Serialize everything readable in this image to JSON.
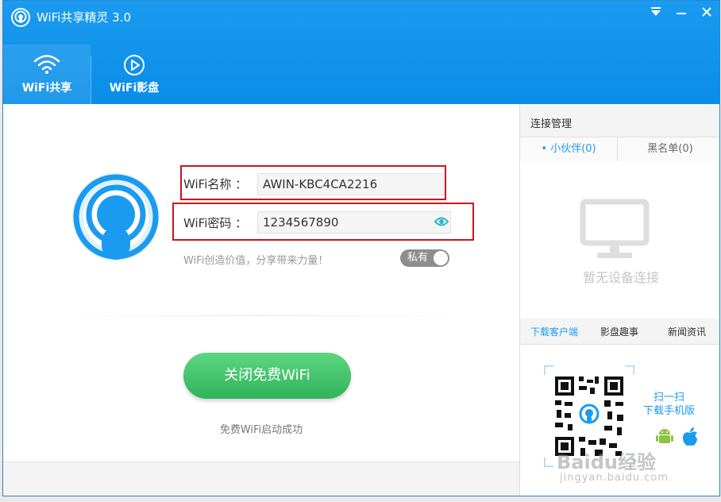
{
  "app": {
    "title": "WiFi共享精灵 3.0"
  },
  "nav": {
    "tabs": [
      {
        "label": "WiFi共享"
      },
      {
        "label": "WiFi影盘"
      }
    ]
  },
  "form": {
    "name_label": "WiFi名称 ：",
    "name_value": "AWIN-KBC4CA2216",
    "password_label": "WiFi密码 ：",
    "password_value": "1234567890",
    "slogan": "WiFi创造价值，分享带来力量！",
    "privacy_toggle": "私有"
  },
  "action": {
    "button_label": "关闭免费WiFi",
    "status": "免费WiFi启动成功"
  },
  "side": {
    "title": "连接管理",
    "tabs": [
      "• 小伙伴(0)",
      "黑名单(0)"
    ],
    "empty_text": "暂无设备连接",
    "links": [
      "下载客户端",
      "影盘趣事",
      "新闻资讯"
    ],
    "scan_line1": "扫一扫",
    "scan_line2": "下载手机版",
    "watermark": "Baidu经验",
    "watermark_url": "jingyan.baidu.com"
  },
  "colors": {
    "accent": "#1a9bf0",
    "button_green": "#3cbf66",
    "highlight_red": "#c9161e"
  }
}
